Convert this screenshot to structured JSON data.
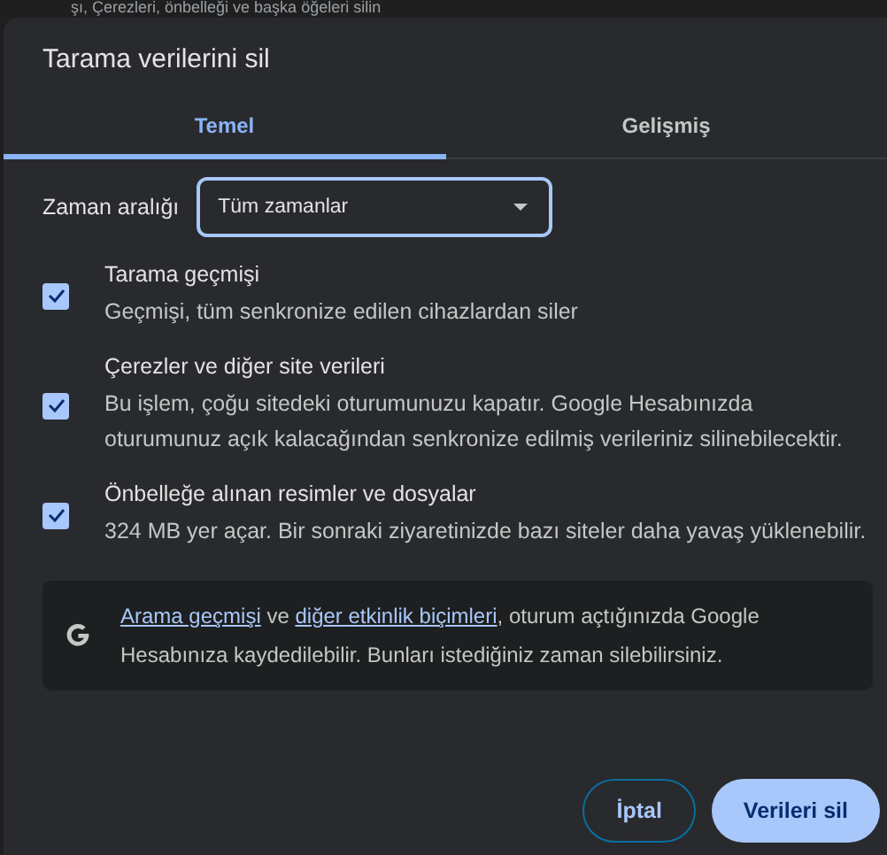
{
  "background_text": "şı, Çerezleri, önbelleği ve başka öğeleri silin",
  "dialog": {
    "title": "Tarama verilerini sil",
    "tabs": [
      {
        "label": "Temel",
        "selected": true
      },
      {
        "label": "Gelişmiş",
        "selected": false
      }
    ],
    "time_range": {
      "label": "Zaman aralığı",
      "value": "Tüm zamanlar"
    },
    "items": [
      {
        "title": "Tarama geçmişi",
        "description": "Geçmişi, tüm senkronize edilen cihazlardan siler",
        "checked": true
      },
      {
        "title": "Çerezler ve diğer site verileri",
        "description": "Bu işlem, çoğu sitedeki oturumunuzu kapatır. Google Hesabınızda oturumunuz açık kalacağından senkronize edilmiş verileriniz silinebilecektir.",
        "checked": true
      },
      {
        "title": "Önbelleğe alınan resimler ve dosyalar",
        "description": "324 MB yer açar. Bir sonraki ziyaretinizde bazı siteler daha yavaş yüklenebilir.",
        "checked": true
      }
    ],
    "info": {
      "link_1": "Arama geçmişi",
      "text_1": "ve",
      "link_2": "diğer etkinlik biçimleri",
      "text_2": ", oturum açtığınızda Google Hesabınıza kaydedilebilir. Bunları istediğiniz zaman silebilirsiniz."
    },
    "buttons": [
      {
        "label": "İptal",
        "kind": "secondary"
      },
      {
        "label": "Verileri sil",
        "kind": "primary"
      }
    ]
  }
}
